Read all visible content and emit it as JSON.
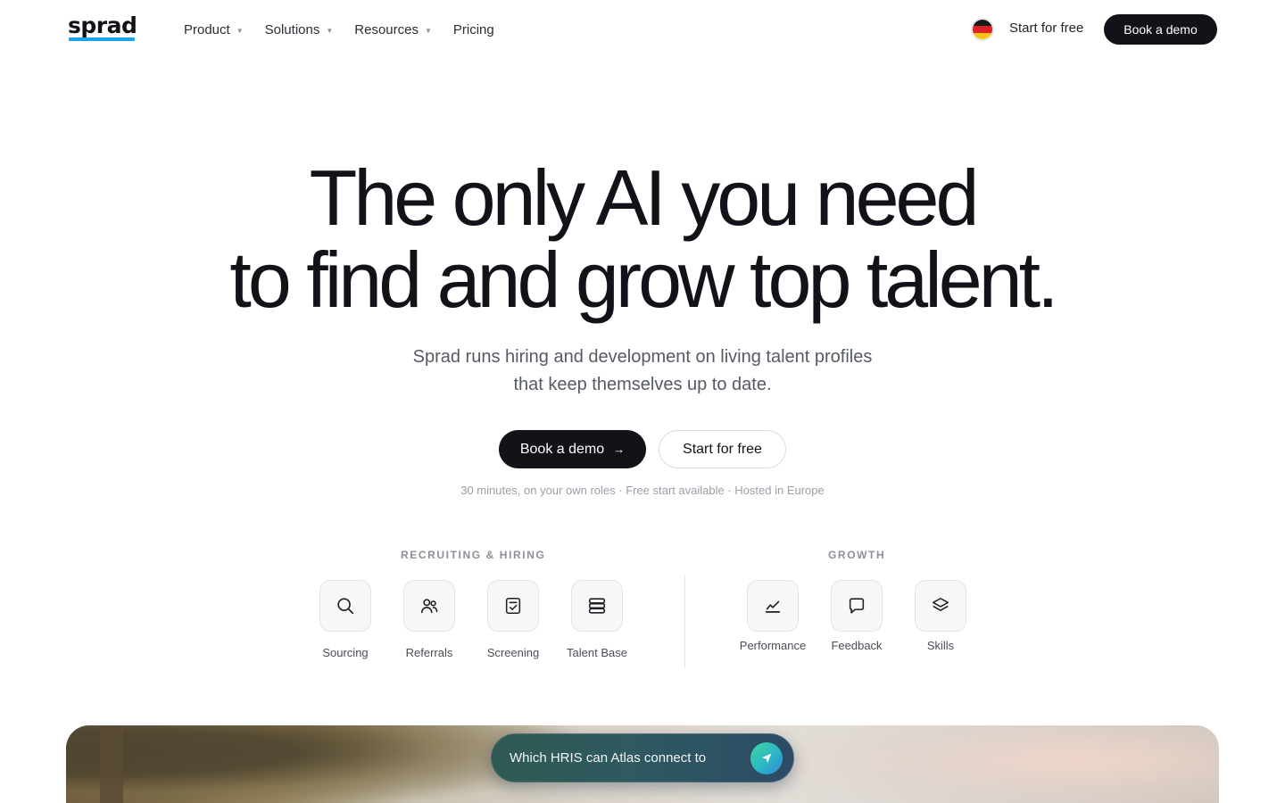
{
  "nav": {
    "logo": "sprad",
    "menu": [
      {
        "label": "Product",
        "has_dropdown": true
      },
      {
        "label": "Solutions",
        "has_dropdown": true
      },
      {
        "label": "Resources",
        "has_dropdown": true
      },
      {
        "label": "Pricing",
        "has_dropdown": false
      }
    ],
    "language_flag": "germany-flag-icon",
    "start_label": "Start for free",
    "demo_label": "Book a demo"
  },
  "hero": {
    "title_line1": "The only AI you need",
    "title_line2": "to find and grow top talent.",
    "subtitle_line1": "Sprad runs hiring and development on living talent profiles",
    "subtitle_line2": "that keep themselves up to date.",
    "cta_primary": "Book a demo",
    "cta_primary_icon": "arrow-right-icon",
    "cta_secondary": "Start for free",
    "note": "30 minutes, on your own roles · Free start available · Hosted in Europe"
  },
  "features": {
    "recruiting": {
      "label": "RECRUITING & HIRING",
      "items": [
        {
          "label": "Sourcing",
          "icon": "search-icon"
        },
        {
          "label": "Referrals",
          "icon": "users-icon"
        },
        {
          "label": "Screening",
          "icon": "clipboard-check-icon"
        },
        {
          "label": "Talent Base",
          "icon": "database-icon"
        }
      ]
    },
    "growth": {
      "label": "GROWTH",
      "items": [
        {
          "label": "Performance",
          "icon": "trend-chart-icon"
        },
        {
          "label": "Feedback",
          "icon": "message-icon"
        },
        {
          "label": "Skills",
          "icon": "layers-icon"
        }
      ]
    }
  },
  "ask": {
    "text": "Which HRIS can Atlas connect to",
    "send_icon": "send-arrow-icon"
  },
  "colors": {
    "ink": "#111318",
    "logo_underline": "#1aa3e8",
    "muted": "#9a9ea6"
  }
}
